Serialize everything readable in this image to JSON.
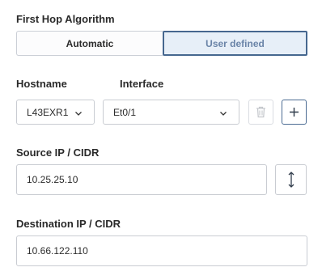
{
  "first_hop": {
    "label": "First Hop Algorithm",
    "options": [
      "Automatic",
      "User defined"
    ],
    "selected": "User defined"
  },
  "hostname": {
    "label": "Hostname",
    "value": "L43EXR1"
  },
  "interface": {
    "label": "Interface",
    "value": "Et0/1"
  },
  "actions": {
    "delete_icon": "trash-icon",
    "add_icon": "plus-icon",
    "swap_icon": "swap-vertical-icon"
  },
  "source": {
    "label": "Source IP / CIDR",
    "value": "10.25.25.10"
  },
  "destination": {
    "label": "Destination IP / CIDR",
    "value": "10.66.122.110"
  },
  "colors": {
    "accent": "#46678f",
    "selected_bg": "#e7eff8",
    "selected_text": "#6a84a8",
    "border": "#c9ccd2"
  }
}
